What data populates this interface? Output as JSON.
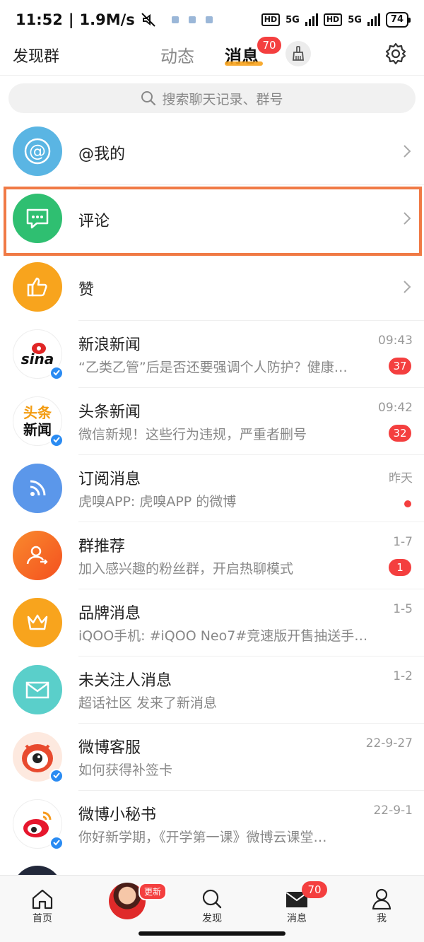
{
  "status_bar": {
    "time": "11:52",
    "speed": "1.9M/s",
    "hd1": "HD",
    "net1": "5G",
    "hd2": "HD",
    "net2": "5G",
    "battery": "74"
  },
  "header": {
    "left_label": "发现群",
    "tabs": [
      "动态",
      "消息"
    ],
    "msg_badge": "70"
  },
  "search": {
    "placeholder": "搜索聊天记录、群号"
  },
  "colors": {
    "accent_orange": "#f7a21b",
    "badge_red": "#f43f3f",
    "highlight": "#f07a45",
    "verified_blue": "#2a8bf2"
  },
  "rows": [
    {
      "title": "@我的",
      "icon": "at-icon",
      "color": "#5ab5e3"
    },
    {
      "title": "评论",
      "icon": "comment-icon",
      "color": "#2fbf71"
    },
    {
      "title": "赞",
      "icon": "thumbs-up-icon",
      "color": "#f8a41d"
    },
    {
      "title": "新浪新闻",
      "subtitle": "“乙类乙管”后是否还要强调个人防护？健康…",
      "time": "09:43",
      "count": "37",
      "avatar_text": "sina"
    },
    {
      "title": "头条新闻",
      "subtitle": "微信新规！这些行为违规，严重者删号",
      "time": "09:42",
      "count": "32",
      "avatar_text": [
        "头条",
        "新闻"
      ]
    },
    {
      "title": "订阅消息",
      "subtitle": "虎嗅APP: 虎嗅APP 的微博",
      "time": "昨天",
      "icon": "rss-icon",
      "color": "#5b97ea"
    },
    {
      "title": "群推荐",
      "subtitle": "加入感兴趣的粉丝群，开启热聊模式",
      "time": "1-7",
      "count": "1",
      "icon": "group-user-icon",
      "color": "#f66b2a"
    },
    {
      "title": "品牌消息",
      "subtitle": "iQOO手机: #iQOO Neo7#竞速版开售抽送手…",
      "time": "1-5",
      "icon": "crown-icon",
      "color": "#f8a41d"
    },
    {
      "title": "未关注人消息",
      "subtitle": "超话社区 发来了新消息",
      "time": "1-2",
      "icon": "mail-icon",
      "color": "#5acfca"
    },
    {
      "title": "微博客服",
      "subtitle": "如何获得补签卡",
      "time": "22-9-27",
      "icon": "weibo-mascot-icon"
    },
    {
      "title": "微博小秘书",
      "subtitle": "你好新学期，《开学第一课》微博云课堂…",
      "time": "22-9-1",
      "icon": "weibo-logo-icon"
    }
  ],
  "bottom_nav": {
    "items": [
      "首页",
      "发现",
      "消息",
      "我"
    ],
    "update_tag": "更新",
    "msg_badge": "70"
  }
}
